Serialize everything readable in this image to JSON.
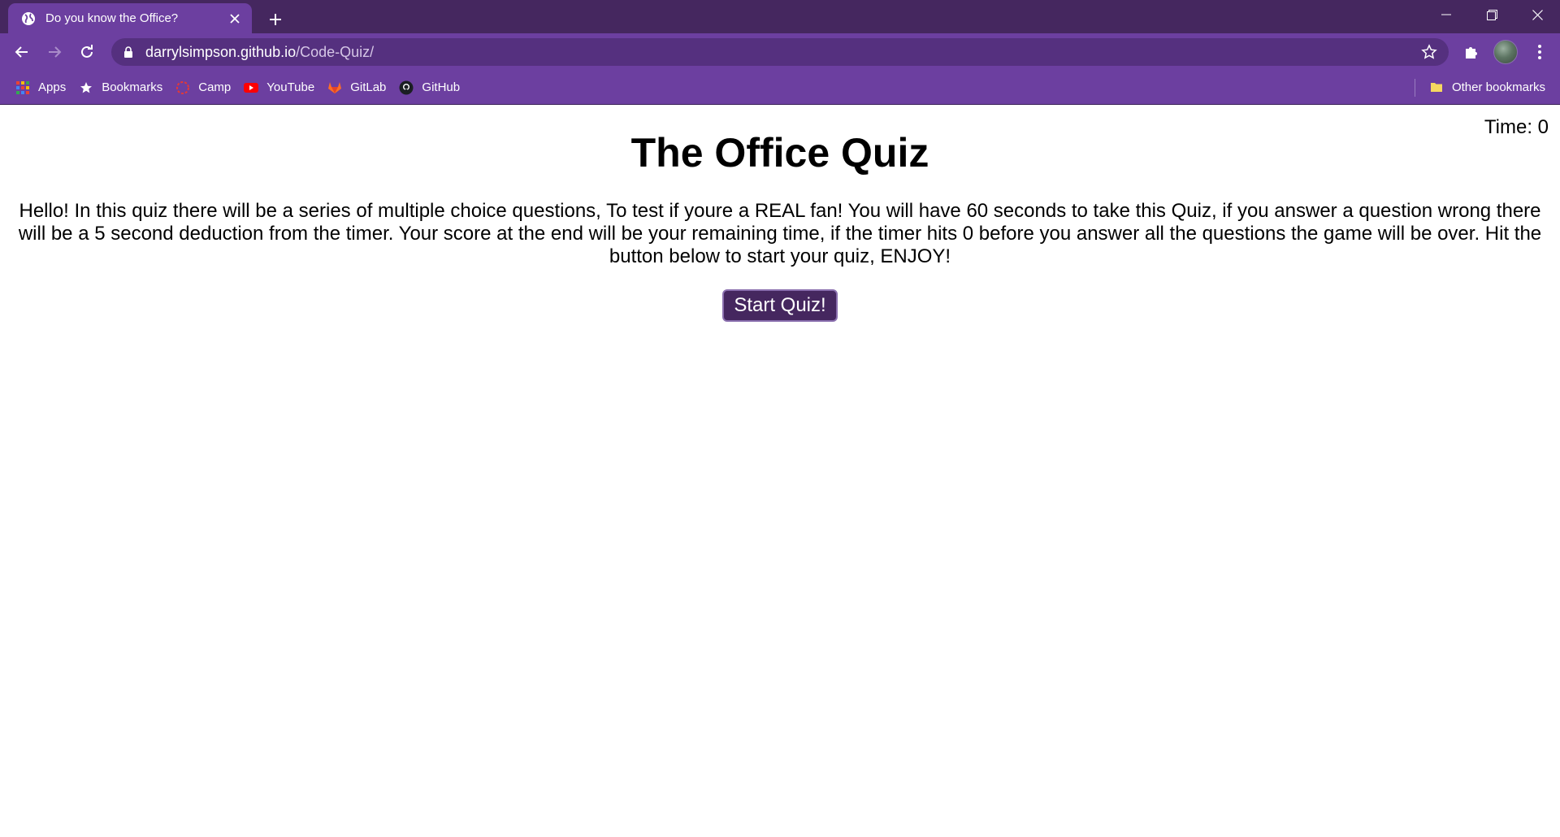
{
  "browser": {
    "tab": {
      "title": "Do you know the Office?"
    },
    "address": {
      "host": "darrylsimpson.github.io",
      "path": "/Code-Quiz/"
    },
    "bookmarks": [
      {
        "label": "Apps",
        "icon": "apps-grid-icon"
      },
      {
        "label": "Bookmarks",
        "icon": "star-icon"
      },
      {
        "label": "Camp",
        "icon": "camp-icon"
      },
      {
        "label": "YouTube",
        "icon": "youtube-icon"
      },
      {
        "label": "GitLab",
        "icon": "gitlab-icon"
      },
      {
        "label": "GitHub",
        "icon": "github-icon"
      }
    ],
    "other_bookmarks": "Other bookmarks",
    "colors": {
      "tab_strip": "#45275f",
      "toolbar": "#6c3fa0",
      "omnibox": "#55307f"
    }
  },
  "page": {
    "timer": "Time: 0",
    "title": "The Office Quiz",
    "intro": "Hello! In this quiz there will be a series of multiple choice questions, To test if youre a REAL fan! You will have 60 seconds to take this Quiz, if you answer a question wrong there will be a 5 second deduction from the timer. Your score at the end will be your remaining time, if the timer hits 0 before you answer all the questions the game will be over. Hit the button below to start your quiz, ENJOY!",
    "start_button": "Start Quiz!",
    "colors": {
      "button_bg": "#45275f",
      "text": "#000000"
    }
  }
}
